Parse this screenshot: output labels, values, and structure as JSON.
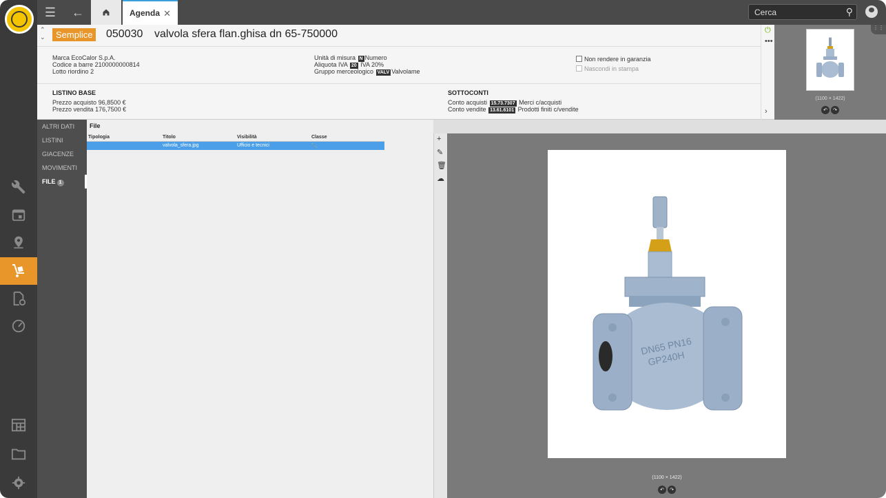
{
  "topbar": {
    "tab_label": "Agenda",
    "search_placeholder": "Cerca"
  },
  "item": {
    "badge": "Semplice",
    "code": "050030",
    "name": "valvola sfera flan.ghisa dn 65-750000"
  },
  "details": {
    "brand": "Marca EcoCalor S.p.A.",
    "barcode_label": "Codice a barre",
    "barcode": "2100000000814",
    "lotto_label": "Lotto riordino",
    "lotto": "2",
    "unit_label": "Unità di misura",
    "unit_chip": "N",
    "unit": "Numero",
    "iva_label": "Aliquota IVA",
    "iva_chip": "20",
    "iva": "IVA 20%",
    "group_label": "Gruppo merceologico",
    "group_chip": "VALV",
    "group": "Valvolame",
    "no_warranty": "Non rendere in garanzia",
    "hide_print": "Nascondi in stampa"
  },
  "listino": {
    "title": "LISTINO BASE",
    "buy_label": "Prezzo acquisto",
    "buy": "96,8500 €",
    "sell_label": "Prezzo vendita",
    "sell": "176,7500 €"
  },
  "sottoconti": {
    "title": "SOTTOCONTI",
    "acq_label": "Conto acquisti",
    "acq_chip": "15.73.7307",
    "acq": "Merci c/acquisti",
    "ven_label": "Conto vendite",
    "ven_chip": "13.61.6101",
    "ven": "Prodotti finiti c/vendite"
  },
  "thumb": {
    "dims": "(1100 × 1422)"
  },
  "tabs": [
    "ALTRI DATI",
    "LISTINI",
    "GIACENZE",
    "MOVIMENTI",
    "FILE"
  ],
  "file_count": "1",
  "files": {
    "title": "File",
    "columns": [
      "Tipologia",
      "Titolo",
      "Visibilità",
      "Classe"
    ],
    "row": {
      "tipologia": "",
      "titolo": "valvola_sfera.jpg",
      "visibilita": "Ufficio e tecnici",
      "classe": "📎"
    }
  },
  "preview": {
    "dims": "(1100 × 1422)"
  }
}
